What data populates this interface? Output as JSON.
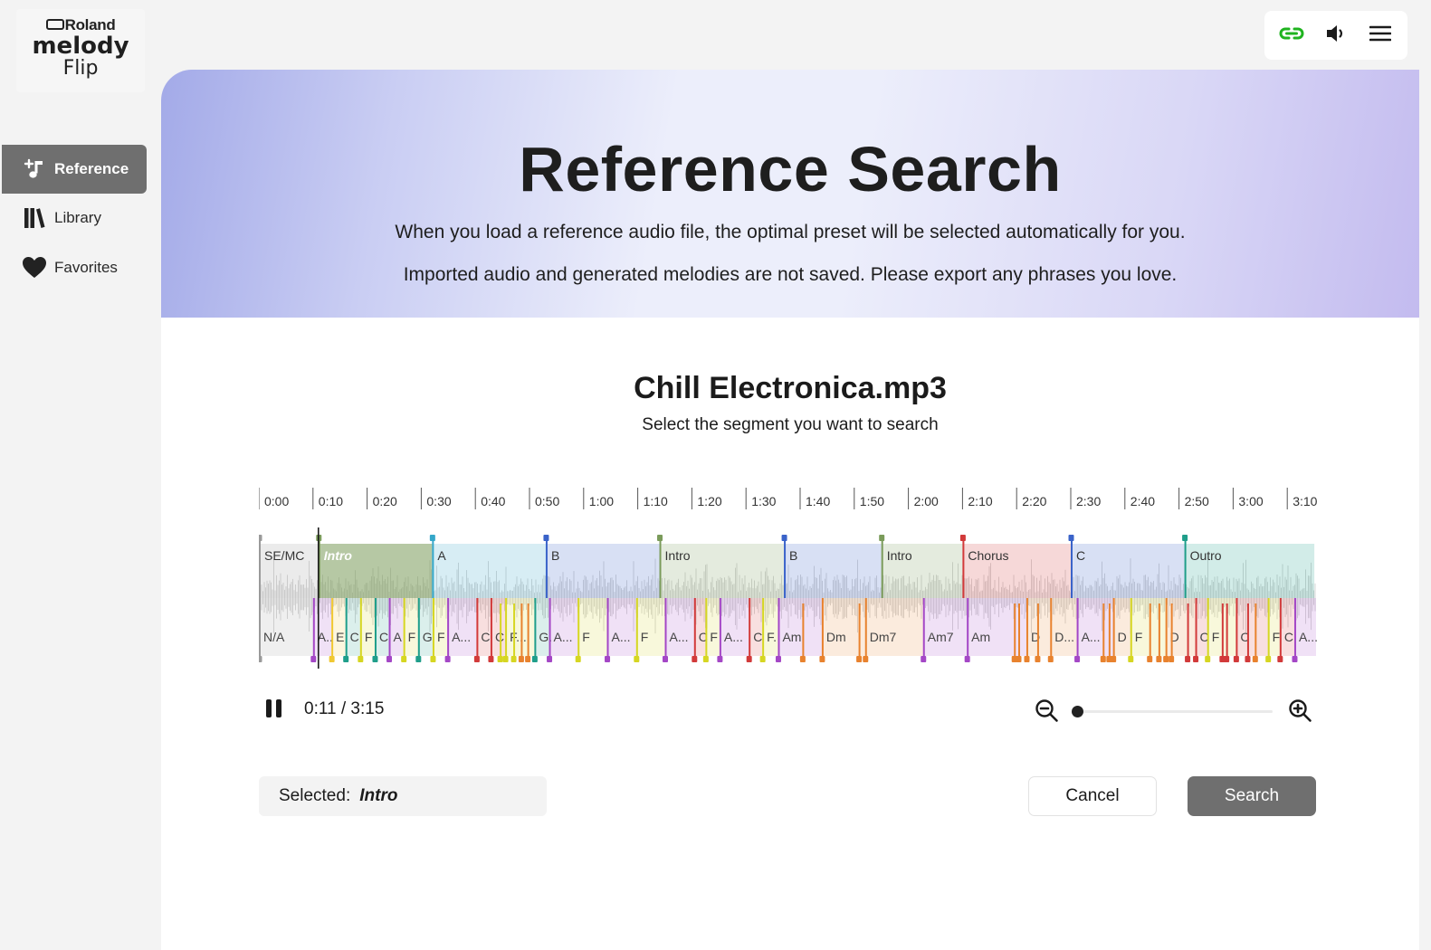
{
  "logo": {
    "brand": "Roland",
    "product_line1": "melody",
    "product_line2": "Flip"
  },
  "sidebar": {
    "items": [
      {
        "label": "Reference",
        "icon": "music-note-plus-icon",
        "active": true
      },
      {
        "label": "Library",
        "icon": "library-books-icon",
        "active": false
      },
      {
        "label": "Favorites",
        "icon": "heart-icon",
        "active": false
      }
    ]
  },
  "toolbar": {
    "icons": [
      "link-icon",
      "speaker-icon",
      "hamburger-menu-icon"
    ],
    "link_color": "#1fb31f"
  },
  "hero": {
    "title": "Reference Search",
    "line1": "When you load a reference audio file, the optimal preset will be selected automatically for you.",
    "line2": "Imported audio and generated melodies are not saved. Please export any phrases you love."
  },
  "file": {
    "name": "Chill Electronica.mp3",
    "instruction": "Select the segment you want to search"
  },
  "timeline": {
    "duration_s": 195,
    "ticks": [
      "0:00",
      "0:10",
      "0:20",
      "0:30",
      "0:40",
      "0:50",
      "1:00",
      "1:10",
      "1:20",
      "1:30",
      "1:40",
      "1:50",
      "2:00",
      "2:10",
      "2:20",
      "2:30",
      "2:40",
      "2:50",
      "3:00",
      "3:10"
    ],
    "sections": [
      {
        "label": "SE/MC",
        "start": 0,
        "end": 11,
        "color": "#9a9a9a"
      },
      {
        "label": "Intro",
        "start": 11,
        "end": 32,
        "color": "#7a9b5a",
        "selected": true
      },
      {
        "label": "A",
        "start": 32,
        "end": 53,
        "color": "#35a7c9"
      },
      {
        "label": "B",
        "start": 53,
        "end": 74,
        "color": "#3a63c9"
      },
      {
        "label": "Intro",
        "start": 74,
        "end": 97,
        "color": "#7a9b5a"
      },
      {
        "label": "B",
        "start": 97,
        "end": 115,
        "color": "#3a63c9"
      },
      {
        "label": "Intro",
        "start": 115,
        "end": 130,
        "color": "#7a9b5a"
      },
      {
        "label": "Chorus",
        "start": 130,
        "end": 150,
        "color": "#d23a3a"
      },
      {
        "label": "C",
        "start": 150,
        "end": 171,
        "color": "#3a63c9"
      },
      {
        "label": "Outro",
        "start": 171,
        "end": 195,
        "color": "#1f9e8a"
      }
    ],
    "chords": [
      {
        "label": "N/A",
        "t": 0,
        "color": "#9a9a9a"
      },
      {
        "label": "A..",
        "t": 10,
        "color": "#a447c6"
      },
      {
        "label": "E",
        "t": 13.4,
        "color": "#f0c832"
      },
      {
        "label": "C",
        "t": 16,
        "color": "#1f9e8a"
      },
      {
        "label": "F",
        "t": 18.7,
        "color": "#d6d622"
      },
      {
        "label": "C",
        "t": 21.4,
        "color": "#1f9e8a"
      },
      {
        "label": "A",
        "t": 24,
        "color": "#a447c6"
      },
      {
        "label": "F",
        "t": 26.7,
        "color": "#d6d622"
      },
      {
        "label": "G",
        "t": 29.4,
        "color": "#1f9e8a"
      },
      {
        "label": "F",
        "t": 32.1,
        "color": "#d6d622"
      },
      {
        "label": "A...",
        "t": 34.8,
        "color": "#a447c6"
      },
      {
        "label": "C",
        "t": 40.2,
        "color": "#d23a3a"
      },
      {
        "label": "C.",
        "t": 42.8,
        "color": "#d23a3a"
      },
      {
        "label": "F...",
        "t": 45.5,
        "color": "#d6d622"
      },
      {
        "label": "G.",
        "t": 50.9,
        "color": "#1f9e8a"
      },
      {
        "label": "A...",
        "t": 53.6,
        "color": "#a447c6"
      },
      {
        "label": "F",
        "t": 58.9,
        "color": "#d6d622"
      },
      {
        "label": "A...",
        "t": 64.3,
        "color": "#a447c6"
      },
      {
        "label": "F",
        "t": 69.7,
        "color": "#d6d622"
      },
      {
        "label": "A...",
        "t": 75,
        "color": "#a447c6"
      },
      {
        "label": "C",
        "t": 80.4,
        "color": "#d23a3a"
      },
      {
        "label": "F",
        "t": 82.5,
        "color": "#d6d622"
      },
      {
        "label": "A...",
        "t": 85.1,
        "color": "#a447c6"
      },
      {
        "label": "C",
        "t": 90.5,
        "color": "#d23a3a"
      },
      {
        "label": "F.",
        "t": 93,
        "color": "#d6d622"
      },
      {
        "label": "Am",
        "t": 95.9,
        "color": "#a447c6"
      },
      {
        "label": "Dm",
        "t": 104,
        "color": "#e8822e"
      },
      {
        "label": "Dm7",
        "t": 112,
        "color": "#e8822e"
      },
      {
        "label": "Am7",
        "t": 122.7,
        "color": "#a447c6"
      },
      {
        "label": "Am",
        "t": 130.8,
        "color": "#a447c6"
      },
      {
        "label": "D",
        "t": 141.8,
        "color": "#e8822e"
      },
      {
        "label": "D...",
        "t": 146.2,
        "color": "#e8822e"
      },
      {
        "label": "A...",
        "t": 151.1,
        "color": "#a447c6"
      },
      {
        "label": "D",
        "t": 157.8,
        "color": "#e8822e"
      },
      {
        "label": "F",
        "t": 161,
        "color": "#d6d622"
      },
      {
        "label": "D",
        "t": 167.5,
        "color": "#e8822e"
      },
      {
        "label": "C",
        "t": 173,
        "color": "#d23a3a"
      },
      {
        "label": "F",
        "t": 175.2,
        "color": "#d6d622"
      },
      {
        "label": "C",
        "t": 180.5,
        "color": "#d23a3a"
      },
      {
        "label": "F",
        "t": 186.4,
        "color": "#d6d622"
      },
      {
        "label": "C.",
        "t": 188.6,
        "color": "#d23a3a"
      },
      {
        "label": "A...",
        "t": 191.3,
        "color": "#a447c6"
      }
    ],
    "extra_markers": [
      {
        "t": 44.5,
        "color": "#d6d622"
      },
      {
        "t": 47,
        "color": "#d6d622"
      },
      {
        "t": 48.4,
        "color": "#e8822e"
      },
      {
        "t": 49.6,
        "color": "#e8822e"
      },
      {
        "t": 100.4,
        "color": "#e8822e"
      },
      {
        "t": 110.8,
        "color": "#e8822e"
      },
      {
        "t": 139.5,
        "color": "#e8822e"
      },
      {
        "t": 140.3,
        "color": "#e8822e"
      },
      {
        "t": 143.8,
        "color": "#e8822e"
      },
      {
        "t": 155.9,
        "color": "#e8822e"
      },
      {
        "t": 157,
        "color": "#e8822e"
      },
      {
        "t": 164.5,
        "color": "#e8822e"
      },
      {
        "t": 166.2,
        "color": "#e8822e"
      },
      {
        "t": 168.5,
        "color": "#e8822e"
      },
      {
        "t": 171.5,
        "color": "#d23a3a"
      },
      {
        "t": 177.9,
        "color": "#d23a3a"
      },
      {
        "t": 178.7,
        "color": "#d23a3a"
      },
      {
        "t": 182.6,
        "color": "#d23a3a"
      },
      {
        "t": 184,
        "color": "#e8822e"
      }
    ],
    "playhead_s": 11
  },
  "player": {
    "time": "0:11 / 3:15",
    "zoom_level": 0
  },
  "selection": {
    "prefix": "Selected:",
    "value": "Intro"
  },
  "buttons": {
    "cancel": "Cancel",
    "search": "Search"
  }
}
